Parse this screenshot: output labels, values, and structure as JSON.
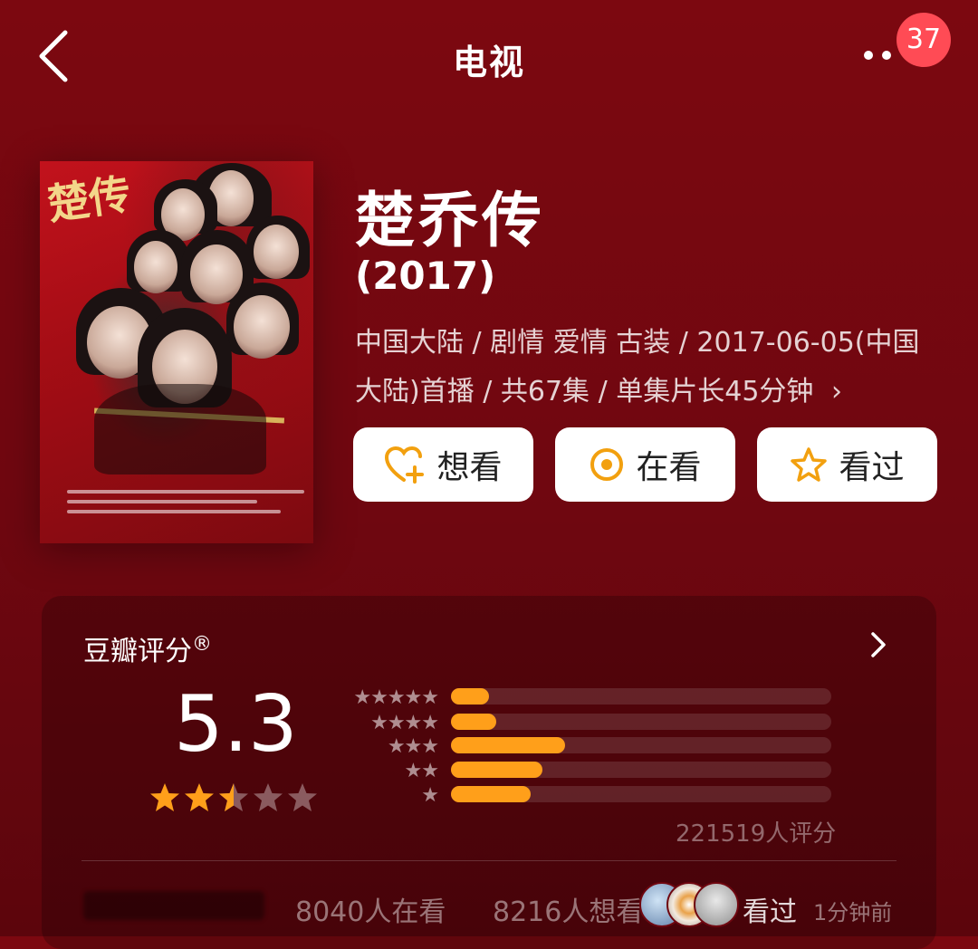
{
  "header": {
    "title": "电视",
    "badge": "37"
  },
  "show": {
    "title": "楚乔传",
    "year": "(2017)",
    "meta": "中国大陆 / 剧情 爱情 古装 / 2017-06-05(中国大陆)首播 / 共67集 / 单集片长45分钟",
    "meta_chevron": "›"
  },
  "actions": [
    {
      "label": "想看",
      "icon": "heart-plus-icon"
    },
    {
      "label": "在看",
      "icon": "circle-dot-icon"
    },
    {
      "label": "看过",
      "icon": "star-outline-icon"
    }
  ],
  "rating": {
    "title": "豆瓣评分",
    "registered": "®",
    "score": "5.3",
    "stars": 2.5,
    "count": "221519人评分",
    "distribution": [
      {
        "stars": "★★★★★",
        "fraction": 0.1
      },
      {
        "stars": "★★★★",
        "fraction": 0.12
      },
      {
        "stars": "★★★",
        "fraction": 0.3
      },
      {
        "stars": "★★",
        "fraction": 0.24
      },
      {
        "stars": "★",
        "fraction": 0.21
      }
    ]
  },
  "activity": {
    "watching": "8040人在看",
    "want": "8216人想看",
    "watched_label": "看过",
    "time": "1分钟前"
  },
  "colors": {
    "accent": "#ff9f1a",
    "background": "#6f0710",
    "badge": "#ff4b55"
  }
}
